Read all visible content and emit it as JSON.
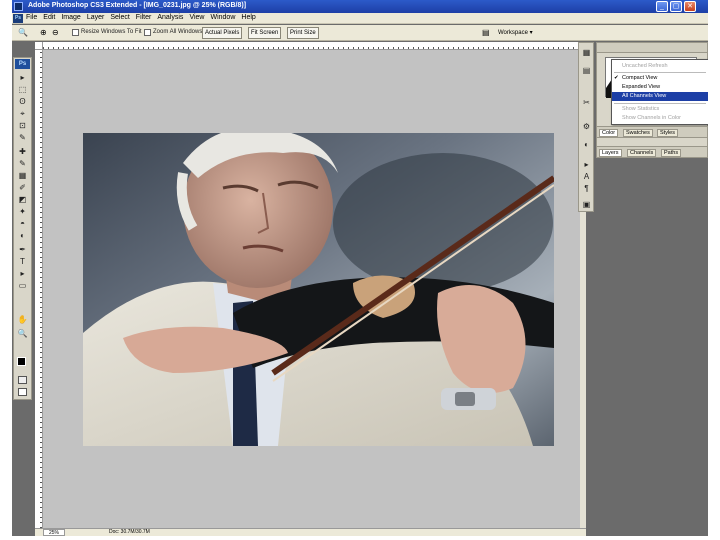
{
  "window": {
    "title": "Adobe Photoshop CS3 Extended - [IMG_0231.jpg @ 25% (RGB/8)]",
    "controls": {
      "minimize": "_",
      "maximize": "▢",
      "close": "✕"
    }
  },
  "menubar": {
    "logo": "Ps",
    "items": [
      "File",
      "Edit",
      "Image",
      "Layer",
      "Select",
      "Filter",
      "Analysis",
      "View",
      "Window",
      "Help"
    ]
  },
  "options_bar": {
    "checkbox_1_label": "Resize Windows To Fit",
    "checkbox_2_label": "Zoom All Windows",
    "buttons": [
      "Actual Pixels",
      "Fit Screen",
      "Print Size"
    ],
    "workspace_label": "Workspace ▾"
  },
  "toolbox": {
    "badge": "Ps",
    "tools": [
      "▸",
      "⬚",
      "ʘ",
      "⌖",
      "⊡",
      "✎",
      "✚",
      "✎",
      "▦",
      "✐",
      "◩",
      "✦",
      "◓",
      "◐",
      "✒",
      "T",
      "▸",
      "▭",
      "✋",
      "🔍"
    ]
  },
  "document": {
    "zoom": "25%",
    "status": "Doc: 30.7M/30.7M",
    "image_name": "IMG_0231.jpg"
  },
  "dock": {
    "icons": [
      "▦",
      "▤",
      "✂",
      "⚙",
      "◐",
      "▸",
      "A",
      "¶",
      "▣"
    ]
  },
  "histogram_menu": {
    "items": [
      {
        "label": "Uncached Refresh",
        "state": "disabled"
      },
      {
        "label": "Compact View",
        "state": "checked"
      },
      {
        "label": "Expanded View",
        "state": "normal"
      },
      {
        "label": "All Channels View",
        "state": "selected"
      },
      {
        "label": "Show Statistics",
        "state": "disabled"
      },
      {
        "label": "Show Channels in Color",
        "state": "disabled"
      }
    ]
  },
  "panels": {
    "group1_tabs": [
      "Color",
      "Swatches",
      "Styles"
    ],
    "group2_tabs": [
      "Layers",
      "Channels",
      "Paths"
    ]
  },
  "colors": {
    "titlebar": "#2c5ac9",
    "menu_selected": "#1d3fa6",
    "canvas_bg": "#c2c2c2",
    "app_bg": "#6b6b6b"
  }
}
